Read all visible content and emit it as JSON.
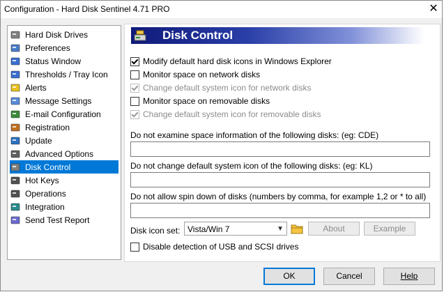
{
  "window": {
    "title": "Configuration  -  Hard Disk Sentinel 4.71 PRO",
    "close_glyph": "✕"
  },
  "nav": {
    "items": [
      {
        "label": "Hard Disk Drives",
        "icon": "hard-drive-icon",
        "selected": false
      },
      {
        "label": "Preferences",
        "icon": "preferences-icon",
        "selected": false
      },
      {
        "label": "Status Window",
        "icon": "window-icon",
        "selected": false
      },
      {
        "label": "Thresholds / Tray Icon",
        "icon": "thresholds-icon",
        "selected": false
      },
      {
        "label": "Alerts",
        "icon": "alert-icon",
        "selected": false
      },
      {
        "label": "Message Settings",
        "icon": "message-icon",
        "selected": false
      },
      {
        "label": "E-mail Configuration",
        "icon": "email-icon",
        "selected": false
      },
      {
        "label": "Registration",
        "icon": "registration-icon",
        "selected": false
      },
      {
        "label": "Update",
        "icon": "globe-icon",
        "selected": false
      },
      {
        "label": "Advanced Options",
        "icon": "advanced-icon",
        "selected": false
      },
      {
        "label": "Disk Control",
        "icon": "disk-control-icon",
        "selected": true
      },
      {
        "label": "Hot Keys",
        "icon": "keyboard-icon",
        "selected": false
      },
      {
        "label": "Operations",
        "icon": "operations-icon",
        "selected": false
      },
      {
        "label": "Integration",
        "icon": "integration-icon",
        "selected": false
      },
      {
        "label": "Send Test Report",
        "icon": "report-icon",
        "selected": false
      }
    ]
  },
  "panel": {
    "title": "Disk Control",
    "checkboxes": [
      {
        "label": "Modify default hard disk icons in Windows Explorer",
        "checked": true,
        "enabled": true
      },
      {
        "label": "Monitor space on network disks",
        "checked": false,
        "enabled": true
      },
      {
        "label": "Change default system icon for network disks",
        "checked": true,
        "enabled": false
      },
      {
        "label": "Monitor space on removable disks",
        "checked": false,
        "enabled": true
      },
      {
        "label": "Change default system icon for removable disks",
        "checked": true,
        "enabled": false
      }
    ],
    "field1": {
      "label": "Do not examine space information of the following disks: (eg: CDE)",
      "value": ""
    },
    "field2": {
      "label": "Do not change default system icon of the following disks: (eg: KL)",
      "value": ""
    },
    "field3": {
      "label": "Do not allow spin down of disks (numbers by comma, for example 1,2 or * to all)",
      "value": ""
    },
    "icon_set": {
      "label": "Disk icon set:",
      "value": "Vista/Win 7",
      "about": "About",
      "example": "Example"
    },
    "usb": {
      "label": "Disable detection of USB and SCSI drives",
      "checked": false
    }
  },
  "buttons": {
    "ok": "OK",
    "cancel": "Cancel",
    "help": "Help"
  }
}
